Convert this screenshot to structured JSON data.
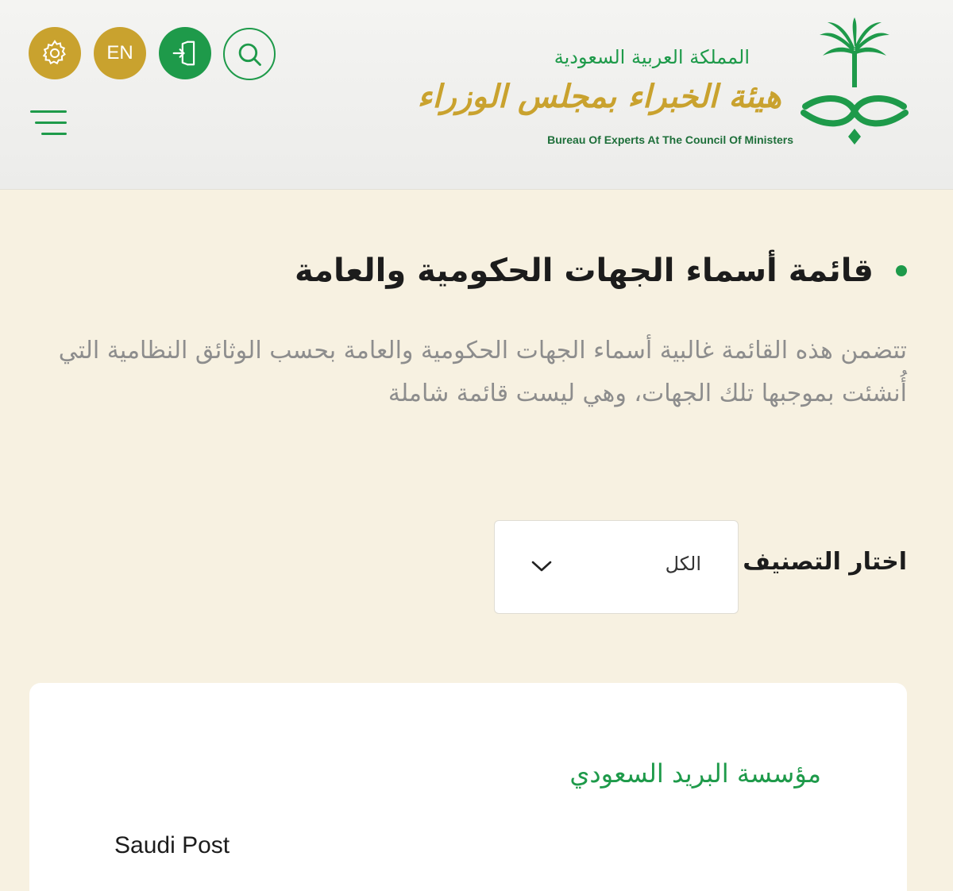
{
  "header": {
    "lang_label": "EN",
    "logo": {
      "kingdom_ar": "المملكة العربية السعودية",
      "bureau_ar": "هيئة الخبراء بمجلس الوزراء",
      "bureau_en": "Bureau Of Experts At The Council Of Ministers"
    },
    "icons": {
      "settings": "gear-icon",
      "login": "login-icon",
      "search": "search-icon",
      "menu": "hamburger-menu-icon"
    },
    "colors": {
      "green": "#1e9a4a",
      "gold": "#c9a22e"
    }
  },
  "page": {
    "title": "قائمة أسماء الجهات الحكومية والعامة",
    "description": "تتضمن هذه القائمة غالبية أسماء الجهات الحكومية والعامة بحسب الوثائق النظامية التي أُنشئت بموجبها تلك الجهات، وهي ليست قائمة شاملة"
  },
  "filter": {
    "label": "اختار التصنيف",
    "selected": "الكل"
  },
  "entries": [
    {
      "name_ar": "مؤسسة البريد السعودي",
      "name_en": "Saudi Post"
    }
  ]
}
